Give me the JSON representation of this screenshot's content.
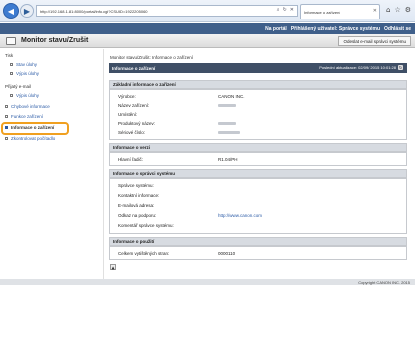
{
  "browser": {
    "url": "http://192.168.1.81:8000/portal/info.cgi?CSUID=1922205060",
    "tab_title": "Informace o zařízení"
  },
  "header": {
    "portal_label": "Na portál",
    "user_label": "Přihlášený uživatel: Správce systému",
    "logout_label": "Odhlásit se"
  },
  "titlebar": {
    "title": "Monitor stavu/Zrušit",
    "mail_button": "Odeslat e-mail správci systému"
  },
  "sidebar": {
    "tisk": "Tisk",
    "stav_uloh": "Stav úlohy",
    "vypis_uloh": "Výpis úlohy",
    "prijaty_email": "Přijatý e-mail",
    "vypis_uloh2": "Výpis úlohy",
    "chybove": "Chybové informace",
    "funkce": "Funkce zařízení",
    "informace": "Informace o zařízení",
    "zkontrolovat": "Zkontrolovat počítadlo"
  },
  "main": {
    "breadcrumb": "Monitor stavu/Zrušit: Informace o zařízení",
    "heading": "Informace o zařízení",
    "last_update": "Poslední aktualizace: 02/09/ 2015 10:01:28",
    "basic_title": "Základní informace o zařízení",
    "basic": {
      "vyrobce": "Výrobce:",
      "vyrobce_val": "CANON INC.",
      "nazev": "Název zařízení:",
      "umisteni": "Umístění:",
      "produktovy": "Produktový název:",
      "seriove": "Sériové číslo:"
    },
    "version_title": "Informace o verzi",
    "version": {
      "label": "Hlavní řadič:",
      "value": "R1.04/PH"
    },
    "admin_title": "Informace o správci systému",
    "admin": {
      "spravce": "Správce systému:",
      "kontaktni": "Kontaktní informace:",
      "email": "E-mailová adresa:",
      "odkaz": "Odkaz na podporu:",
      "odkaz_val": "http://www.canon.com",
      "komentar": "Komentář správce systému:"
    },
    "usage_title": "Informace o použití",
    "usage": {
      "label": "Celkem vytištěných stran:",
      "value": "0000110"
    }
  },
  "footer": {
    "copyright": "Copyright CANON INC. 2015"
  }
}
